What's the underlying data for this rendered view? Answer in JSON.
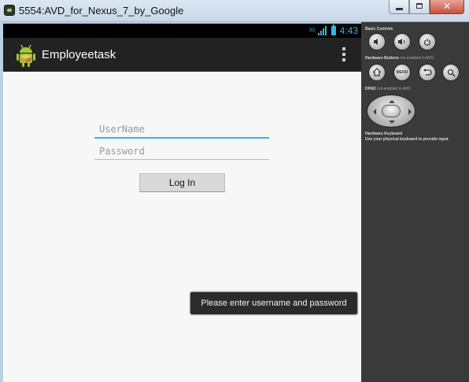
{
  "window": {
    "title": "5554:AVD_for_Nexus_7_by_Google",
    "close_label": "✕"
  },
  "status_bar": {
    "time": "4:43",
    "network_label": "3G"
  },
  "action_bar": {
    "title": "Employeetask"
  },
  "login_form": {
    "username_placeholder": "UserName",
    "password_placeholder": "Password",
    "login_label": "Log In"
  },
  "toast": {
    "message": "Please enter  username and password"
  },
  "controls_panel": {
    "basic_controls": "Basic Controls",
    "hardware_buttons": "Hardware Buttons",
    "hardware_buttons_note": "not enabled in AVD",
    "dpad": "DPAD",
    "dpad_note": "not enabled in AVD",
    "keyboard_title": "Hardware Keyboard",
    "keyboard_note": "Use your physical keyboard to provide input",
    "menu_label": "MENU"
  },
  "colors": {
    "accent": "#33b5e5",
    "panel_bg": "#3a3a3a",
    "action_bar_bg": "#222222"
  }
}
